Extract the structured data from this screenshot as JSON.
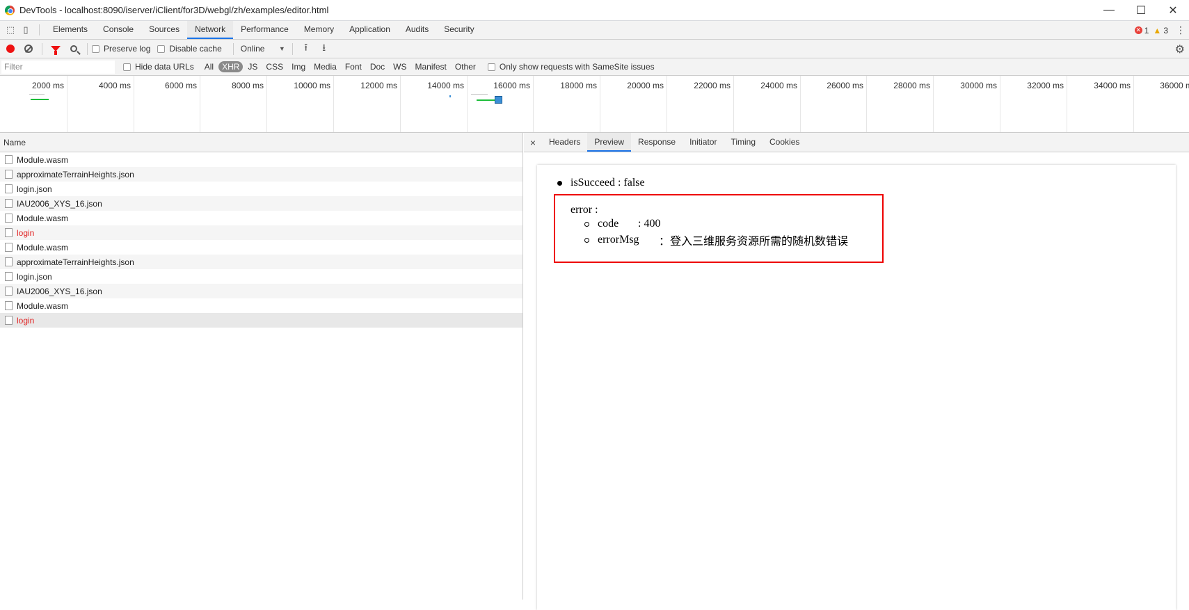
{
  "window": {
    "title": "DevTools - localhost:8090/iserver/iClient/for3D/webgl/zh/examples/editor.html",
    "controls": [
      "—",
      "☐",
      "✕"
    ]
  },
  "main_tabs": [
    "Elements",
    "Console",
    "Sources",
    "Network",
    "Performance",
    "Memory",
    "Application",
    "Audits",
    "Security"
  ],
  "active_main_tab": "Network",
  "badges": {
    "errors": "1",
    "warnings": "3"
  },
  "toolbar": {
    "preserve_log": "Preserve log",
    "disable_cache": "Disable cache",
    "throttling": "Online"
  },
  "filter": {
    "placeholder": "Filter",
    "hide_data_urls": "Hide data URLs",
    "types": [
      "All",
      "XHR",
      "JS",
      "CSS",
      "Img",
      "Media",
      "Font",
      "Doc",
      "WS",
      "Manifest",
      "Other"
    ],
    "active_type": "XHR",
    "samesite": "Only show requests with SameSite issues"
  },
  "overview": {
    "labels": [
      "2000 ms",
      "4000 ms",
      "6000 ms",
      "8000 ms",
      "10000 ms",
      "12000 ms",
      "14000 ms",
      "16000 ms",
      "18000 ms",
      "20000 ms",
      "22000 ms",
      "24000 ms",
      "26000 ms",
      "28000 ms",
      "30000 ms",
      "32000 ms",
      "34000 ms",
      "36000 ms"
    ]
  },
  "requests": {
    "header": "Name",
    "rows": [
      {
        "name": "Module.wasm",
        "failed": false
      },
      {
        "name": "approximateTerrainHeights.json",
        "failed": false
      },
      {
        "name": "login.json",
        "failed": false
      },
      {
        "name": "IAU2006_XYS_16.json",
        "failed": false
      },
      {
        "name": "Module.wasm",
        "failed": false
      },
      {
        "name": "login",
        "failed": true
      },
      {
        "name": "Module.wasm",
        "failed": false
      },
      {
        "name": "approximateTerrainHeights.json",
        "failed": false
      },
      {
        "name": "login.json",
        "failed": false
      },
      {
        "name": "IAU2006_XYS_16.json",
        "failed": false
      },
      {
        "name": "Module.wasm",
        "failed": false
      },
      {
        "name": "login",
        "failed": true
      }
    ]
  },
  "detail": {
    "close": "×",
    "tabs": [
      "Headers",
      "Preview",
      "Response",
      "Initiator",
      "Timing",
      "Cookies"
    ],
    "active_tab": "Preview"
  },
  "preview": {
    "is_succeed": "isSucceed : false",
    "error_label": "error :",
    "code_key": "code",
    "code_value": ": 400",
    "msg_key": "errorMsg",
    "msg_value": "：登入三维服务资源所需的随机数错误"
  },
  "colors": {
    "accent": "#1a73e8",
    "error": "#e01f1f",
    "highlight_box": "#e00000"
  }
}
